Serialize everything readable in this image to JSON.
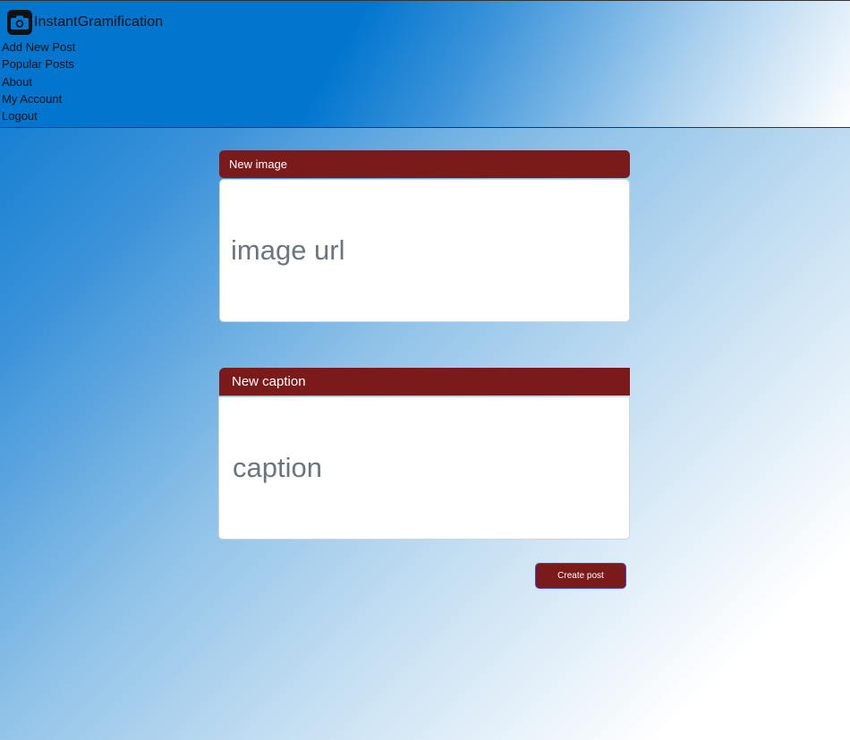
{
  "app": {
    "brand_name": "InstantGramification",
    "brand_icon": "camera-icon"
  },
  "nav": {
    "items": [
      {
        "label": "Add New Post"
      },
      {
        "label": "Popular Posts"
      },
      {
        "label": "About"
      },
      {
        "label": "My Account"
      },
      {
        "label": "Logout"
      }
    ]
  },
  "form": {
    "image": {
      "header": "New image",
      "placeholder": "image url",
      "value": ""
    },
    "caption": {
      "header": "New caption",
      "placeholder": "caption",
      "value": ""
    },
    "submit_label": "Create post"
  },
  "colors": {
    "accent": "#7b1a1a",
    "header_blue": "#0276cf",
    "button_border": "#3b4bd6"
  }
}
